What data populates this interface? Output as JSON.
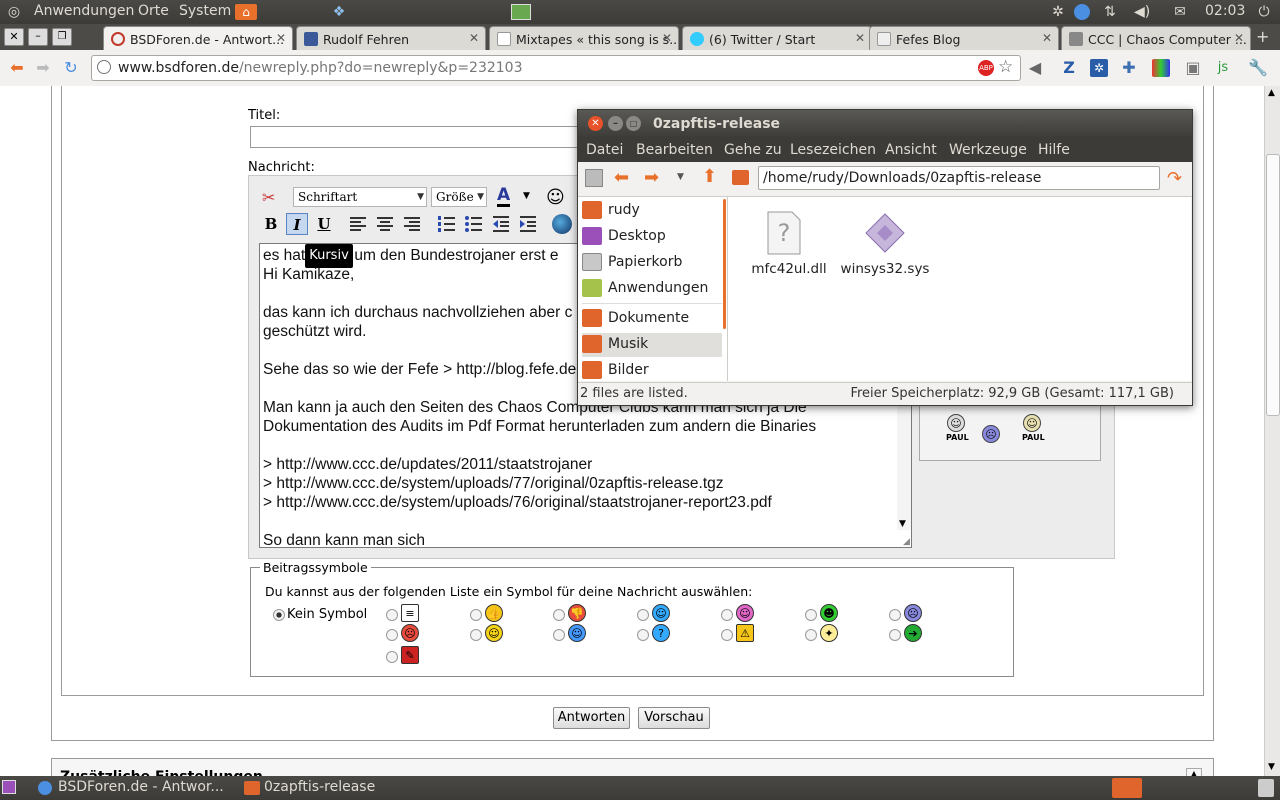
{
  "top_panel": {
    "menus": [
      "Anwendungen",
      "Orte",
      "System"
    ],
    "clock": "02:03",
    "icons": [
      "ubuntu-logo-icon",
      "home-folder-icon",
      "steam-icon",
      "battery-icon",
      "settings-icon",
      "chrome-icon",
      "network-icon",
      "volume-icon",
      "mail-icon",
      "power-icon"
    ]
  },
  "browser": {
    "tabs": [
      {
        "label": "BSDForen.de - Antwort...",
        "favicon_color": "#c0392b"
      },
      {
        "label": "Rudolf Fehren",
        "favicon_color": "#3b5998"
      },
      {
        "label": "Mixtapes « this song is s...",
        "favicon_color": "#ffffff"
      },
      {
        "label": "(6) Twitter / Start",
        "favicon_color": "#33ccff"
      },
      {
        "label": "Fefes Blog",
        "favicon_color": "#dddddd"
      },
      {
        "label": "CCC | Chaos Computer ...",
        "favicon_color": "#888888"
      }
    ],
    "url_domain": "www.bsdforen.de",
    "url_path": "/newreply.php?do=newreply&p=232103"
  },
  "form": {
    "title_label": "Titel:",
    "message_label": "Nachricht:",
    "font_select": "Schriftart",
    "size_select": "Größe",
    "bold": "B",
    "italic": "I",
    "underline": "U",
    "tooltip": "Kursiv",
    "message_lines": [
      "es hatte sich um den Bundestrojaner erst e",
      "Hi Kamikaze,",
      "",
      "das kann ich durchaus nachvollziehen aber c",
      "geschützt wird.",
      "",
      "Sehe das so wie der Fefe > http://blog.fefe.de",
      "",
      "Man kann ja auch den Seiten des Chaos Computer Clubs kann man sich ja Die",
      "Dokumentation des Audits im Pdf Format herunterladen zum andern die Binaries",
      "",
      "> http://www.ccc.de/updates/2011/staatstrojaner",
      "> http://www.ccc.de/system/uploads/77/original/0zapftis-release.tgz",
      "> http://www.ccc.de/system/uploads/76/original/staatstrojaner-report23.pdf",
      "",
      "So dann kann man sich"
    ],
    "smiley_labels": [
      "PAUL",
      "PAUL"
    ]
  },
  "symbols": {
    "legend": "Beitragssymbole",
    "instruction": "Du kannst aus der folgenden Liste ein Symbol für deine Nachricht auswählen:",
    "none_label": "Kein Symbol",
    "icons": [
      {
        "name": "document-icon",
        "color": "#ffffff",
        "glyph": "≡"
      },
      {
        "name": "thumbs-up-icon",
        "color": "#f5c518",
        "glyph": "👍"
      },
      {
        "name": "thumbs-down-icon",
        "color": "#e74c3c",
        "glyph": "👎"
      },
      {
        "name": "happy-face-icon",
        "color": "#33aaff",
        "glyph": "☺"
      },
      {
        "name": "smile-pink-icon",
        "color": "#e066c8",
        "glyph": "☺"
      },
      {
        "name": "grin-icon",
        "color": "#33cc33",
        "glyph": "☻"
      },
      {
        "name": "sad-purple-icon",
        "color": "#8888dd",
        "glyph": "☹"
      },
      {
        "name": "angry-face-icon",
        "color": "#e84c3c",
        "glyph": "☹"
      },
      {
        "name": "smile-yellow-icon",
        "color": "#f5d318",
        "glyph": "☺"
      },
      {
        "name": "cool-face-icon",
        "color": "#4499ff",
        "glyph": "☺"
      },
      {
        "name": "question-icon",
        "color": "#33aaff",
        "glyph": "?"
      },
      {
        "name": "warning-icon",
        "color": "#f5c518",
        "glyph": "⚠"
      },
      {
        "name": "lightbulb-icon",
        "color": "#ffee99",
        "glyph": "✦"
      },
      {
        "name": "arrow-right-icon",
        "color": "#22aa33",
        "glyph": "➔"
      },
      {
        "name": "pencil-icon",
        "color": "#cc2222",
        "glyph": "✎"
      }
    ]
  },
  "buttons": {
    "reply": "Antworten",
    "preview": "Vorschau"
  },
  "extra": {
    "heading": "Zusätzliche Einstellungen"
  },
  "file_manager": {
    "title": "0zapftis-release",
    "menu": [
      "Datei",
      "Bearbeiten",
      "Gehe zu",
      "Lesezeichen",
      "Ansicht",
      "Werkzeuge",
      "Hilfe"
    ],
    "location": "/home/rudy/Downloads/0zapftis-release",
    "sidebar": [
      {
        "label": "rudy",
        "color": "#e0652c"
      },
      {
        "label": "Desktop",
        "color": "#9b4fb8"
      },
      {
        "label": "Papierkorb",
        "color": "#c8c8c8"
      },
      {
        "label": "Anwendungen",
        "color": "#a5c34a"
      },
      {
        "label": "Dokumente",
        "color": "#e0652c"
      },
      {
        "label": "Musik",
        "color": "#e0652c"
      },
      {
        "label": "Bilder",
        "color": "#e0652c"
      }
    ],
    "files": [
      {
        "name": "mfc42ul.dll",
        "icon": "unknown-file-icon"
      },
      {
        "name": "winsys32.sys",
        "icon": "system-file-icon"
      }
    ],
    "status_left": "2 files are listed.",
    "status_right": "Freier Speicherplatz: 92,9 GB (Gesamt: 117,1 GB)"
  },
  "taskbar": {
    "items": [
      {
        "label": "BSDForen.de - Antwor...",
        "icon": "chrome-icon"
      },
      {
        "label": "0zapftis-release",
        "icon": "folder-icon"
      }
    ]
  }
}
